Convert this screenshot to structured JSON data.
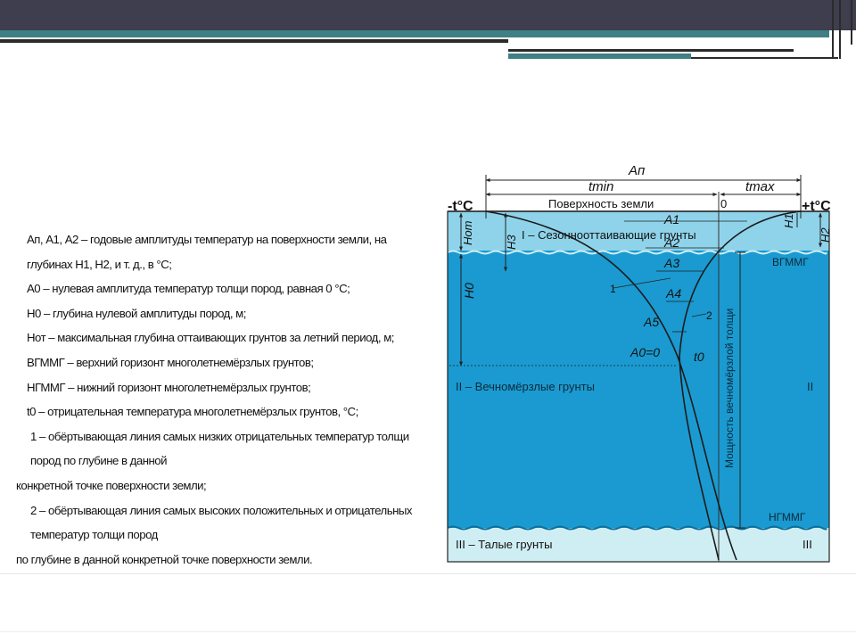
{
  "legend": {
    "l1": "Ап, А1, А2 – годовые амплитуды температур на поверхности земли, на глубинах H1, H2, и т. д., в °С;",
    "l2": "А0 – нулевая амплитуда температур толщи пород, равная 0 °С;",
    "l3": "H0 – глубина нулевой амплитуды пород, м;",
    "l4": "Hот – максимальная глубина оттаивающих грунтов за летний период, м;",
    "l5": "ВГММГ – верхний горизонт многолетнемёрзлых грунтов;",
    "l6": "НГММГ – нижний горизонт многолетнемёрзлых грунтов;",
    "l7": "t0 – отрицательная температура многолетнемёрзлых грунтов, °С;",
    "l8a": "1 – обёртывающая линия самых низких отрицательных температур толщи пород по глубине в данной",
    "l8b": "конкретной точке поверхности земли;",
    "l9a": "2 – обёртывающая линия самых высоких положительных и отрицательных температур толщи пород",
    "l9b": "по глубине в данной конкретной точке поверхности земли."
  },
  "diagram": {
    "a_n": "Aп",
    "t_min": "tmin",
    "t_max": "tmax",
    "minus_t": "-t°C",
    "plus_t": "+t°C",
    "surface": "Поверхность земли",
    "zero": "0",
    "a1": "A1",
    "a2": "A2",
    "a3": "A3",
    "a4": "A4",
    "a5": "A5",
    "a0": "A0=0",
    "t0": "t0",
    "h_ot": "Hот",
    "h1": "H1",
    "h2": "H2",
    "h3": "H3",
    "h0": "H0",
    "zone1": "I – Сезоннооттаивающие грунты",
    "zone2": "II – Вечномёрзлые грунты",
    "zone2_right": "II",
    "zone3": "III – Талые грунты",
    "zone3_right": "III",
    "vgmmg": "ВГММГ",
    "ngmmg": "НГММГ",
    "curve1": "1",
    "curve2": "2",
    "thickness": "Мощность вечномёрзлой толщи"
  },
  "colors": {
    "thaw_layer": "#8fd3ea",
    "permafrost": "#1a9ad0",
    "talik": "#cfeef4"
  }
}
